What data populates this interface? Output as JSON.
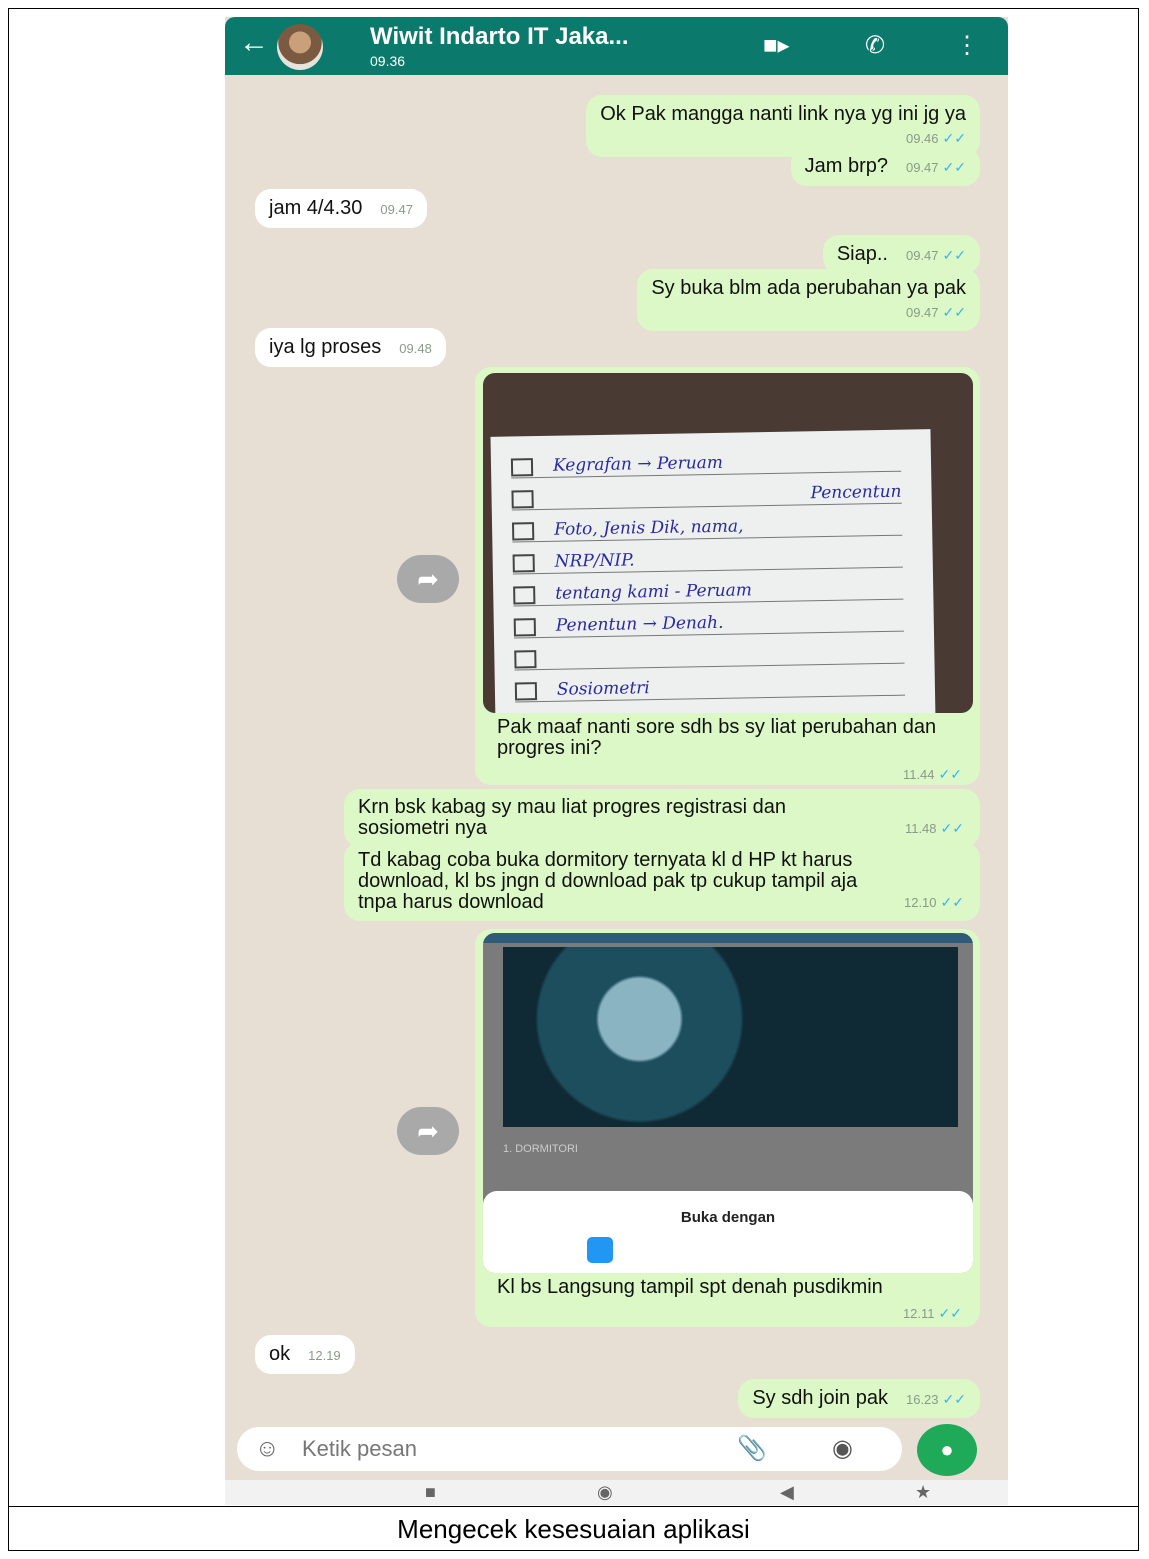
{
  "header": {
    "title": "Wiwit Indarto IT Jaka...",
    "subtitle": "09.36",
    "back": "←",
    "video_icon": "video-call-icon",
    "call_icon": "phone-icon",
    "menu_icon": "kebab-menu-icon"
  },
  "messages": [
    {
      "dir": "out",
      "text": "Ok Pak mangga nanti link nya yg ini jg ya",
      "time": "09.46",
      "read": "✓✓"
    },
    {
      "dir": "out",
      "text": "Jam brp?",
      "time": "09.47",
      "read": "✓✓"
    },
    {
      "dir": "in",
      "text": "jam 4/4.30",
      "time": "09.47"
    },
    {
      "dir": "out",
      "text": "Siap..",
      "time": "09.47",
      "read": "✓✓"
    },
    {
      "dir": "out",
      "text": "Sy buka blm ada perubahan ya pak",
      "time": "09.47",
      "read": "✓✓"
    },
    {
      "dir": "in",
      "text": "iya lg proses",
      "time": "09.48"
    },
    {
      "dir": "out",
      "text": "Pak maaf nanti sore sdh bs sy liat perubahan dan progres ini?",
      "time": "11.44",
      "read": "✓✓"
    },
    {
      "dir": "out",
      "text": "Krn bsk kabag sy mau liat progres registrasi dan sosiometri nya",
      "time": "11.48",
      "read": "✓✓"
    },
    {
      "dir": "out",
      "text": "Td kabag coba buka dormitory ternyata kl d HP kt harus download, kl bs jngn d download pak tp cukup tampil aja tnpa harus download",
      "time": "12.10",
      "read": "✓✓"
    },
    {
      "dir": "out",
      "text": "Kl bs Langsung tampil spt denah pusdikmin",
      "time": "12.11",
      "read": "✓✓"
    },
    {
      "dir": "in",
      "text": "ok",
      "time": "12.19"
    },
    {
      "dir": "out",
      "text": "Sy sdh join pak",
      "time": "16.23",
      "read": "✓✓"
    }
  ],
  "note_lines": [
    "Kegrafan → Peruam",
    "Pencentun",
    "Foto, Jenis Dik, nama,",
    "NRP/NIP.",
    "tentang kami - Peruam",
    "Penentun → Denah.",
    "",
    "Sosiometri"
  ],
  "image2": {
    "label": "1. DORMITORI",
    "sheet_title": "Buka dengan"
  },
  "composer": {
    "placeholder": "Ketik pesan",
    "emoji_icon": "emoji-icon",
    "attach_icon": "paperclip-icon",
    "camera_icon": "camera-icon",
    "mic_icon": "microphone-icon"
  },
  "caption": "Mengecek kesesuaian aplikasi",
  "colors": {
    "header": "#0b7a6c",
    "outgoing": "#dcf8c6",
    "incoming": "#ffffff",
    "mic": "#1faa59"
  }
}
